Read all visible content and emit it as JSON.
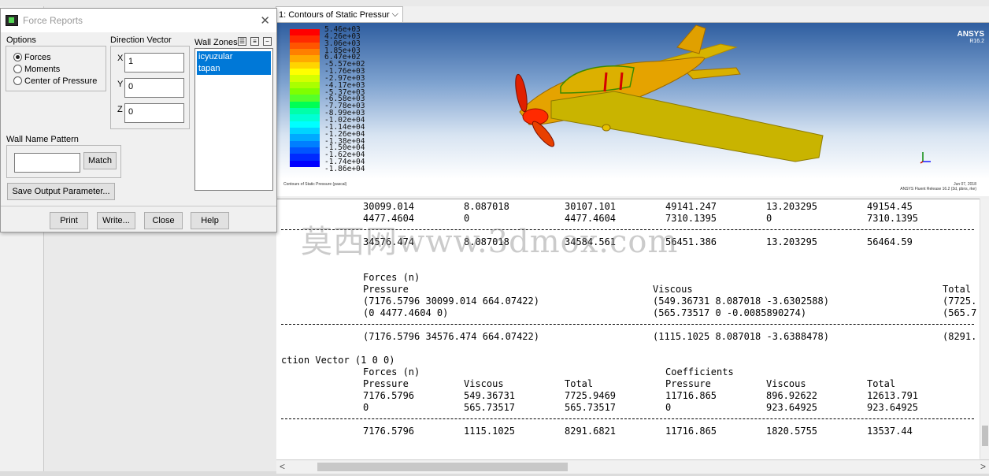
{
  "dialog": {
    "title": "Force Reports",
    "options_label": "Options",
    "options": [
      "Forces",
      "Moments",
      "Center of Pressure"
    ],
    "selected_option": "Forces",
    "direction_label": "Direction Vector",
    "x_label": "X",
    "x_value": "1",
    "y_label": "Y",
    "y_value": "0",
    "z_label": "Z",
    "z_value": "0",
    "wall_zones_label": "Wall Zones",
    "wall_zones": [
      "icyuzular",
      "tapan"
    ],
    "wall_name_pattern_label": "Wall Name Pattern",
    "wall_name_pattern_value": "",
    "match_button": "Match",
    "save_output_button": "Save Output Parameter...",
    "buttons": {
      "print": "Print",
      "write": "Write...",
      "close": "Close",
      "help": "Help"
    }
  },
  "graphics_tab": {
    "label": "1: Contours of Static Pressur"
  },
  "legend": {
    "values": [
      "5.46e+03",
      "4.26e+03",
      "3.06e+03",
      "1.85e+03",
      "6.47e+02",
      "-5.57e+02",
      "-1.76e+03",
      "-2.97e+03",
      "-4.17e+03",
      "-5.37e+03",
      "-6.58e+03",
      "-7.78e+03",
      "-8.99e+03",
      "-1.02e+04",
      "-1.14e+04",
      "-1.26e+04",
      "-1.38e+04",
      "-1.50e+04",
      "-1.62e+04",
      "-1.74e+04",
      "-1.86e+04"
    ],
    "colors": [
      "#ff0000",
      "#ff2a00",
      "#ff5500",
      "#ff7f00",
      "#ffaa00",
      "#ffd400",
      "#ffff00",
      "#d4ff00",
      "#aaff00",
      "#7fff00",
      "#55ff2a",
      "#00ff55",
      "#00ffaa",
      "#00ffd4",
      "#00ffff",
      "#00d4ff",
      "#00aaff",
      "#007fff",
      "#0055ff",
      "#002aff",
      "#0000ff"
    ]
  },
  "brand": {
    "name": "ANSYS",
    "version": "R16.2"
  },
  "viewport_captions": {
    "left": "Contours of Static Pressure (pascal)",
    "right_1": "Jun 07, 2018",
    "right_2": "ANSYS Fluent Release 16.2 (3d, pbns, rke)"
  },
  "console": {
    "rows_top": [
      [
        "30099.014",
        "8.087018",
        "30107.101",
        "49141.247",
        "13.203295",
        "49154.45"
      ],
      [
        "4477.4604",
        "0",
        "4477.4604",
        "7310.1395",
        "0",
        "7310.1395"
      ]
    ],
    "totals_top": [
      "34576.474",
      "8.087018",
      "34584.561",
      "56451.386",
      "13.203295",
      "56464.59"
    ],
    "forces_label": "Forces (n)",
    "pressure_label": "Pressure",
    "viscous_label": "Viscous",
    "total_label": "Total",
    "vec_pressure_1": "(7176.5796 30099.014 664.07422)",
    "vec_pressure_2": "(0 4477.4604 0)",
    "vec_viscous_1": "(549.36731 8.087018 -3.6302588)",
    "vec_viscous_2": "(565.73517 0 -0.0085890274)",
    "vec_total_1": "(7725.",
    "vec_total_2": "(565.7",
    "vec_pressure_sum": "(7176.5796 34576.474 664.07422)",
    "vec_viscous_sum": "(1115.1025 8.087018 -3.6388478)",
    "vec_total_sum": "(8291.",
    "direction_text": "ction Vector (1 0 0)",
    "coefficients_label": "Coefficients",
    "rows_bottom": [
      [
        "7176.5796",
        "549.36731",
        "7725.9469",
        "11716.865",
        "896.92622",
        "12613.791"
      ],
      [
        "0",
        "565.73517",
        "565.73517",
        "0",
        "923.64925",
        "923.64925"
      ]
    ],
    "totals_bottom": [
      "7176.5796",
      "1115.1025",
      "8291.6821",
      "11716.865",
      "1820.5755",
      "13537.44"
    ]
  },
  "watermark": "莫西网www.3dmox.com"
}
